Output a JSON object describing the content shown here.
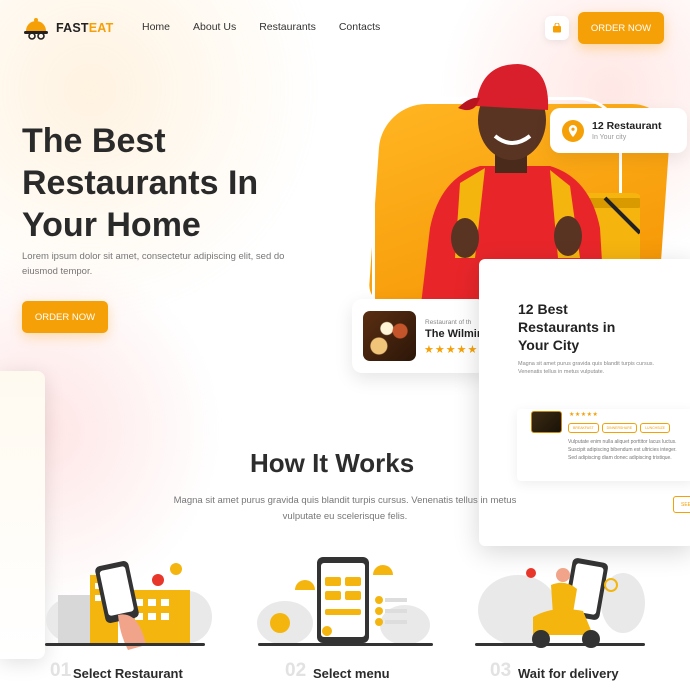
{
  "brand": {
    "name_part1": "FAST",
    "name_part2": "EAT",
    "accent": "#f5a007"
  },
  "nav": {
    "items": [
      "Home",
      "About Us",
      "Restaurants",
      "Contacts"
    ]
  },
  "header": {
    "cart_icon": "shopping-bag-icon",
    "order_label": "ORDER NOW"
  },
  "hero": {
    "title_lines": [
      "The Best",
      "Restaurants In",
      "Your Home"
    ],
    "description": "Lorem ipsum dolor sit amet, consectetur adipiscing elit, sed do eiusmod tempor.",
    "order_label": "ORDER NOW"
  },
  "location_card": {
    "icon": "map-pin-icon",
    "title": "12 Restaurant",
    "subtitle": "In Your city"
  },
  "restaurant_card": {
    "label": "Restaurant of th",
    "name": "The Wilmin",
    "stars": "★★★★★"
  },
  "right_panel": {
    "title_lines": [
      "12 Best",
      "Restaurants in",
      "Your City"
    ],
    "description": "Magna sit amet purus gravida quis blandit turpis cursus. Venenatis tellus in metus vulputate.",
    "stars": "★★★★★",
    "tags": [
      "BREAKFAST",
      "DINNERSHARE",
      "LUNCHSIZE"
    ],
    "text": "Vulputate enim nulla aliquet porttitor lacus luctus. Suscipit adipiscing bibendum est ultricies integer. Sed adipiscing diam donec adipiscing tristique.",
    "button_label": "SEE"
  },
  "how": {
    "title": "How It Works",
    "description": "Magna sit amet purus gravida quis blandit turpis cursus. Venenatis tellus in metus vulputate eu scelerisque felis."
  },
  "steps": [
    {
      "num": "01",
      "label": "Select Restaurant"
    },
    {
      "num": "02",
      "label": "Select menu"
    },
    {
      "num": "03",
      "label": "Wait for delivery"
    }
  ]
}
